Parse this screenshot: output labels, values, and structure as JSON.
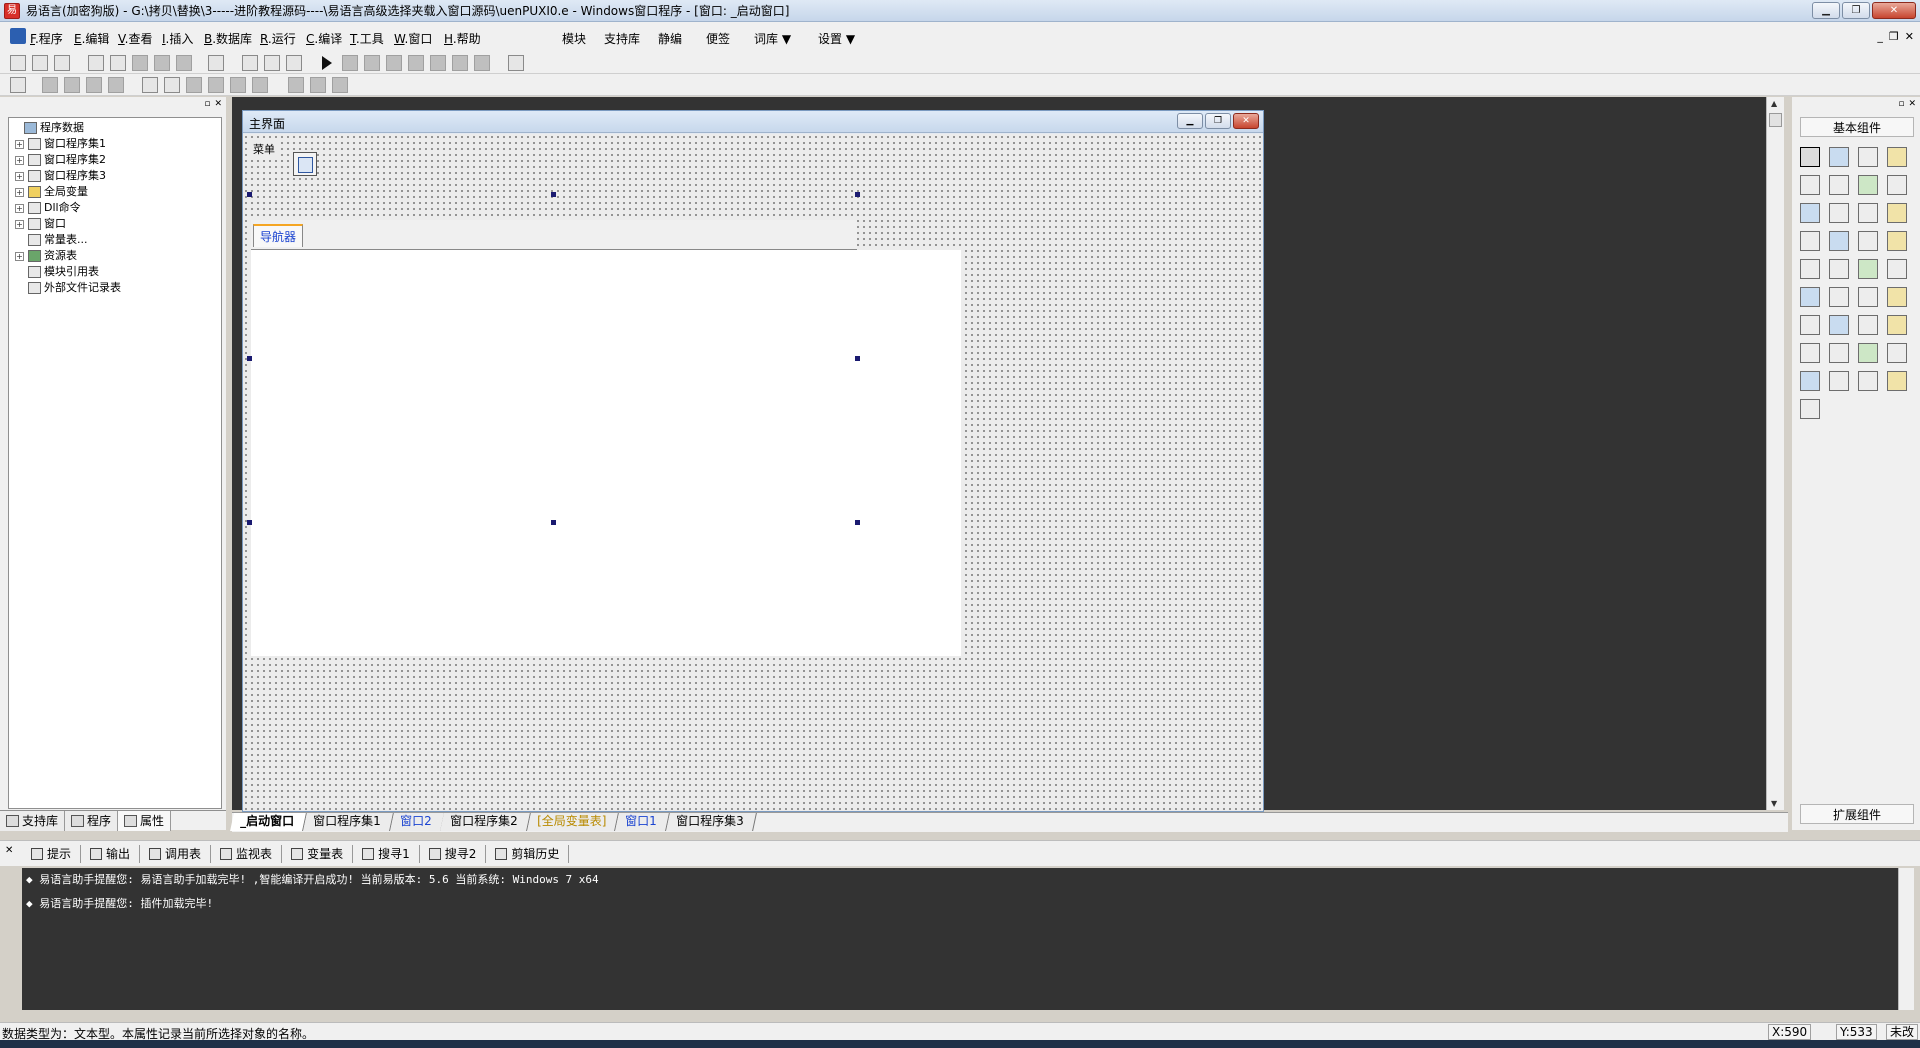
{
  "window": {
    "title": "易语言(加密狗版) - G:\\拷贝\\替换\\3-----进阶教程源码----\\易语言高级选择夹载入窗口源码\\uenPUXI0.e - Windows窗口程序 - [窗口: _启动窗口]",
    "app_icon_glyph": "易",
    "minimize_glyph": "▁",
    "maximize_glyph": "❐",
    "close_glyph": "✕"
  },
  "menu": {
    "items": [
      {
        "key": "F",
        "rest": ".程序"
      },
      {
        "key": "E",
        "rest": ".编辑"
      },
      {
        "key": "V",
        "rest": ".查看"
      },
      {
        "key": "I",
        "rest": ".插入"
      },
      {
        "key": "B",
        "rest": ".数据库"
      },
      {
        "key": "R",
        "rest": ".运行"
      },
      {
        "key": "C",
        "rest": ".编译"
      },
      {
        "key": "T",
        "rest": ".工具"
      },
      {
        "key": "W",
        "rest": ".窗口"
      },
      {
        "key": "H",
        "rest": ".帮助"
      }
    ],
    "extra": [
      "模块",
      "支持库",
      "静编",
      "便签",
      "词库 ▼",
      "设置 ▼"
    ],
    "mdi_buttons": [
      "_",
      "❐",
      "✕"
    ]
  },
  "left_panel": {
    "header_buttons": [
      "▫",
      "✕"
    ],
    "tree": [
      {
        "label": "程序数据",
        "expander": "",
        "icon": "db"
      },
      {
        "label": "窗口程序集1",
        "expander": "+",
        "icon": "plain"
      },
      {
        "label": "窗口程序集2",
        "expander": "+",
        "icon": "plain"
      },
      {
        "label": "窗口程序集3",
        "expander": "+",
        "icon": "plain"
      },
      {
        "label": "全局变量",
        "expander": "+",
        "icon": "yellow"
      },
      {
        "label": "Dll命令",
        "expander": "+",
        "icon": "plain"
      },
      {
        "label": "窗口",
        "expander": "+",
        "icon": "plain"
      },
      {
        "label": "常量表...",
        "expander": "",
        "icon": "plain"
      },
      {
        "label": "资源表",
        "expander": "+",
        "icon": "green"
      },
      {
        "label": "模块引用表",
        "expander": "",
        "icon": "plain"
      },
      {
        "label": "外部文件记录表",
        "expander": "",
        "icon": "plain"
      }
    ],
    "tabs": [
      "支持库",
      "程序",
      "属性"
    ]
  },
  "form": {
    "title": "主界面",
    "menu_label": "菜单",
    "navigator_tab": "导航器",
    "buttons": [
      "▁",
      "❐",
      "✕"
    ]
  },
  "right_panel": {
    "header_buttons": [
      "▫",
      "✕"
    ],
    "title": "基本组件",
    "bottom_title": "扩展组件",
    "components_count_visible": 37
  },
  "editor_tabs": [
    {
      "label": "_启动窗口",
      "style": "active"
    },
    {
      "label": "窗口程序集1",
      "style": ""
    },
    {
      "label": "窗口2",
      "style": "blue"
    },
    {
      "label": "窗口程序集2",
      "style": ""
    },
    {
      "label": "[全局变量表]",
      "style": "yellow"
    },
    {
      "label": "窗口1",
      "style": "blue"
    },
    {
      "label": "窗口程序集3",
      "style": ""
    }
  ],
  "output_tabs": [
    "提示",
    "输出",
    "调用表",
    "监视表",
    "变量表",
    "搜寻1",
    "搜寻2",
    "剪辑历史"
  ],
  "output": {
    "close_glyph": "✕",
    "lines": [
      "◆ 易语言助手提醒您: 易语言助手加载完毕! ,智能编译开启成功! 当前易版本: 5.6 当前系统: Windows 7 x64",
      "◆ 易语言助手提醒您: 插件加载完毕!"
    ]
  },
  "status": {
    "text": "数据类型为：文本型。本属性记录当前所选择对象的名称。",
    "x": "X:590",
    "y": "Y:533",
    "state": "未改"
  }
}
